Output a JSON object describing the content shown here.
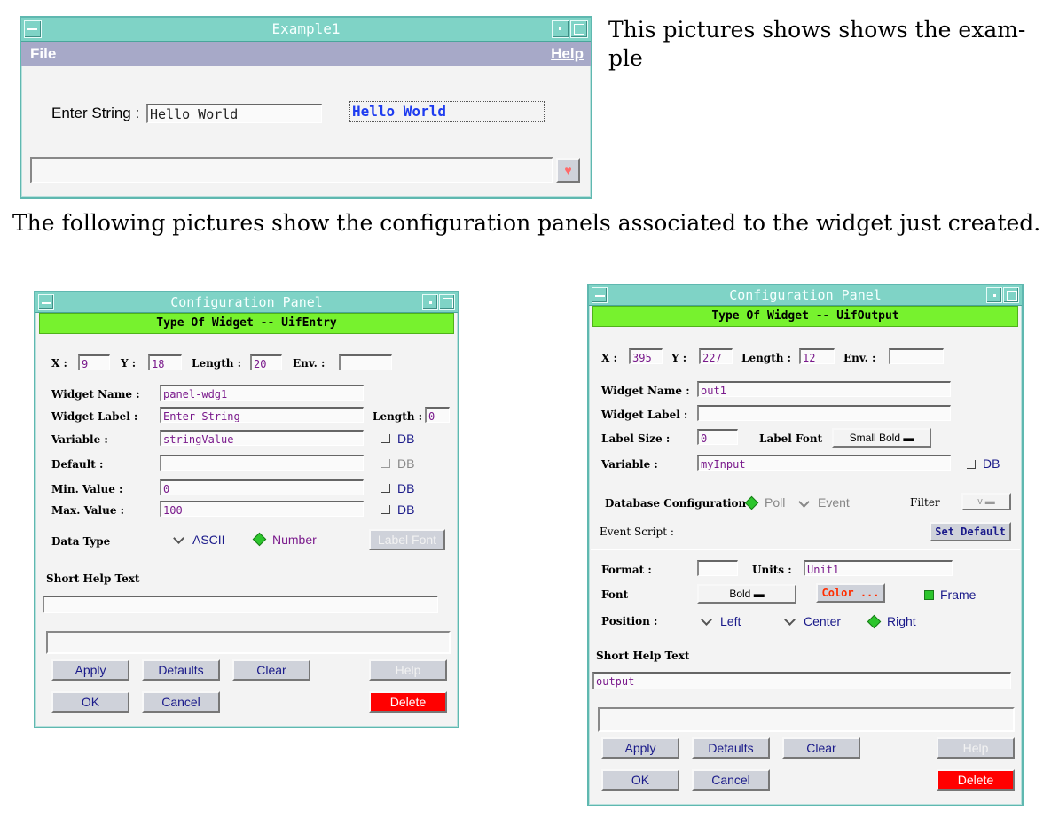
{
  "intro_text": [
    "This pictures shows shows the exam-",
    "ple"
  ],
  "caption": "The following pictures show the configuration panels associated to the widget just created.",
  "colors": {
    "title_bar": "#7fd3c6",
    "banner": "#77f22e",
    "menubar": "#a7a9c8",
    "delete": "#ff0000"
  },
  "example_window": {
    "title": "Example1",
    "menu_file": "File",
    "menu_help": "Help",
    "entry_label": "Enter String :",
    "entry_value": "Hello World",
    "output_value": "Hello World",
    "heart_icon": "♥"
  },
  "entry_panel": {
    "title": "Configuration Panel",
    "banner": "Type Of Widget   --   UifEntry",
    "x_label": "X :",
    "x_value": "9",
    "y_label": "Y :",
    "y_value": "18",
    "length_label": "Length :",
    "length_value": "20",
    "env_label": "Env. :",
    "env_value": "",
    "widget_name_label": "Widget Name :",
    "widget_name_value": "panel-wdg1",
    "widget_label_label": "Widget Label :",
    "widget_label_value": "Enter String",
    "label_length_label": "Length :",
    "label_length_value": "0",
    "variable_label": "Variable :",
    "variable_value": "stringValue",
    "default_label": "Default :",
    "default_value": "",
    "min_label": "Min. Value :",
    "min_value": "0",
    "max_label": "Max. Value :",
    "max_value": "100",
    "db": "DB",
    "data_type_label": "Data Type",
    "type_ascii": "ASCII",
    "type_number": "Number",
    "label_font_button": "Label Font",
    "short_help_label": "Short Help Text",
    "short_help_value": "",
    "buttons": {
      "apply": "Apply",
      "defaults": "Defaults",
      "clear": "Clear",
      "help": "Help",
      "ok": "OK",
      "cancel": "Cancel",
      "delete": "Delete"
    }
  },
  "output_panel": {
    "title": "Configuration Panel",
    "banner": "Type Of Widget   --   UifOutput",
    "x_label": "X :",
    "x_value": "395",
    "y_label": "Y :",
    "y_value": "227",
    "length_label": "Length :",
    "length_value": "12",
    "env_label": "Env. :",
    "env_value": "",
    "widget_name_label": "Widget Name :",
    "widget_name_value": "out1",
    "widget_label_label": "Widget Label :",
    "widget_label_value": "",
    "label_size_label": "Label Size :",
    "label_size_value": "0",
    "label_font_label": "Label Font",
    "label_font_value": "Small Bold",
    "variable_label": "Variable :",
    "variable_value": "myInput",
    "db": "DB",
    "db_config_label": "Database Configuration",
    "poll": "Poll",
    "event": "Event",
    "filter_label": "Filter",
    "filter_value": "v",
    "event_script_label": "Event Script :",
    "set_default_button": "Set Default",
    "format_label": "Format :",
    "format_value": "",
    "units_label": "Units :",
    "units_value": "Unit1",
    "font_label": "Font",
    "font_value": "Bold",
    "color_button": "Color ...",
    "frame": "Frame",
    "position_label": "Position :",
    "pos_left": "Left",
    "pos_center": "Center",
    "pos_right": "Right",
    "short_help_label": "Short Help Text",
    "short_help_value": "output",
    "buttons": {
      "apply": "Apply",
      "defaults": "Defaults",
      "clear": "Clear",
      "help": "Help",
      "ok": "OK",
      "cancel": "Cancel",
      "delete": "Delete"
    }
  }
}
